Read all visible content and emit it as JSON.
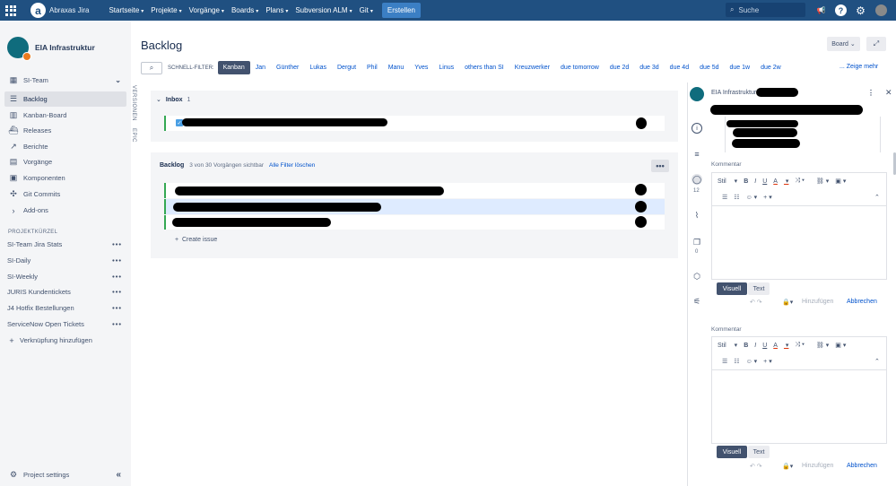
{
  "topnav": {
    "brand": "Abraxas Jira",
    "items": [
      "Startseite",
      "Projekte",
      "Vorgänge",
      "Boards",
      "Plans",
      "Subversion ALM",
      "Git"
    ],
    "create": "Erstellen",
    "search_placeholder": "Suche",
    "color": "#205081"
  },
  "sidebar": {
    "project_name": "EIA Infrastruktur",
    "team": "SI-Team",
    "items": [
      "Backlog",
      "Kanban-Board",
      "Releases",
      "Berichte",
      "Vorgänge",
      "Komponenten",
      "Git Commits",
      "Add-ons"
    ],
    "active": "Backlog",
    "section_label": "PROJEKTKÜRZEL",
    "shortcuts": [
      "SI-Team Jira Stats",
      "SI-Daily",
      "SI-Weekly",
      "JURIS Kundentickets",
      "J4 Hotfix Bestellungen",
      "ServiceNow Open Tickets"
    ],
    "add_link": "Verknüpfung hinzufügen",
    "settings": "Project settings"
  },
  "rail": {
    "versions": "VERSIONEN",
    "epics": "EPIC"
  },
  "main": {
    "title": "Backlog",
    "board_button": "Board",
    "filter_label": "SCHNELL-FILTER:",
    "quick_filters": [
      "Kanban",
      "Jan",
      "Günther",
      "Lukas",
      "Dergut",
      "Phil",
      "Manu",
      "Yves",
      "Linus",
      "others than SI",
      "Kreuzwerker",
      "due tomorrow",
      "due 2d",
      "due 3d",
      "due 4d",
      "due 5d",
      "due 1w",
      "due 2w"
    ],
    "active_filter": "Kanban",
    "more_link": "... Zeige mehr",
    "inbox": {
      "title": "Inbox",
      "count": "1"
    },
    "backlog": {
      "title": "Backlog",
      "visible": "3 von 30 Vorgängen sichtbar",
      "clear_filters": "Alle Filter löschen",
      "create_issue": "Create issue"
    }
  },
  "detail": {
    "project": "EIA Infrastruktur",
    "comment_count": "12",
    "attach_count": "0",
    "comment_label": "Kommentar",
    "toolbar": {
      "style": "Stil",
      "bold": "B",
      "italic": "I",
      "underline": "U",
      "text_color": "A"
    },
    "visual": "Visuell",
    "text": "Text",
    "add": "Hinzufügen",
    "cancel": "Abbrechen"
  }
}
